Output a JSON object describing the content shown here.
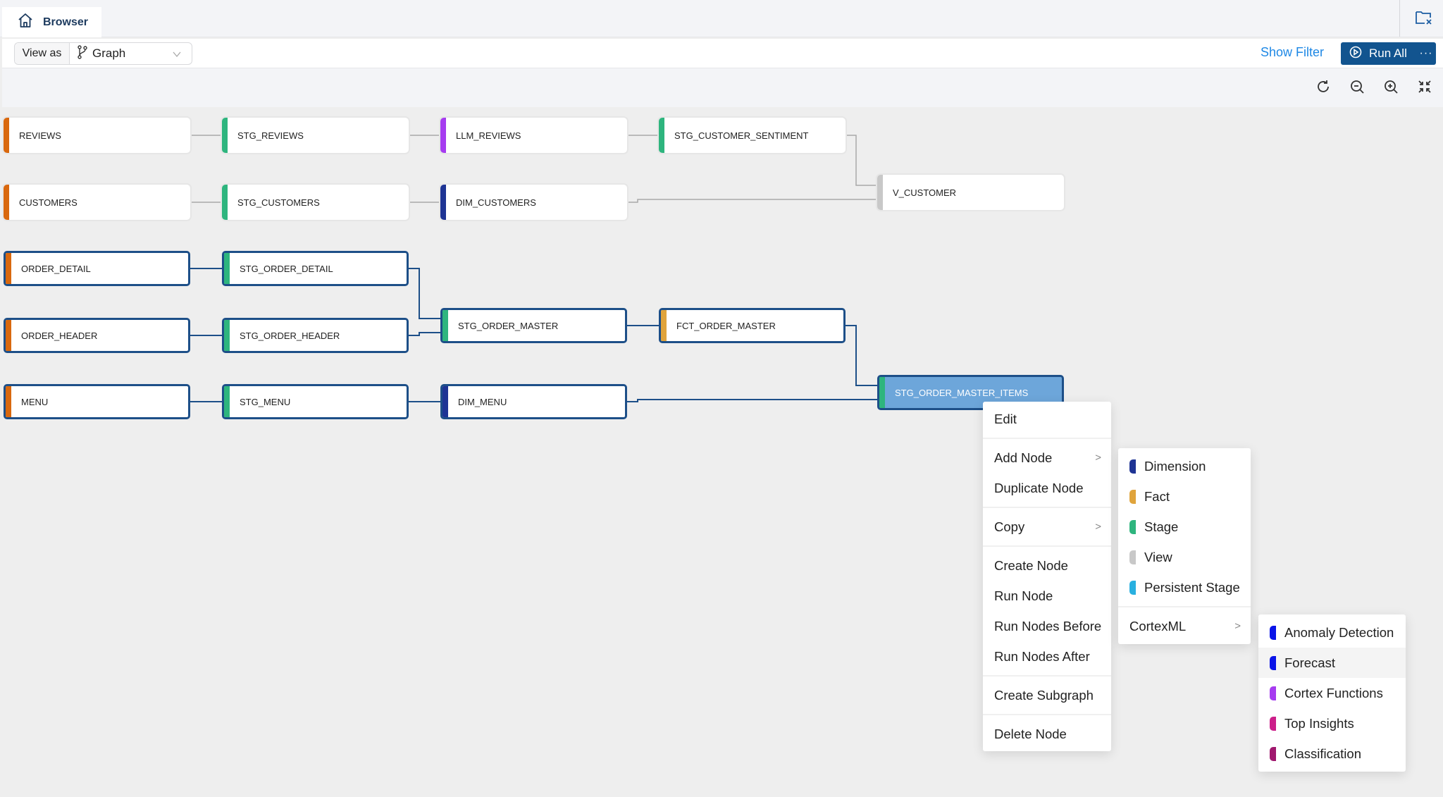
{
  "tabs": [
    {
      "label": "Browser",
      "icon": "home-icon",
      "active": true
    }
  ],
  "header_right_icon": "folder-close-icon",
  "toolbar": {
    "view_as_label": "View as",
    "view_mode": "Graph",
    "view_mode_icon": "branch-icon",
    "show_filter_label": "Show Filter",
    "run_all_label": "Run All",
    "run_all_more": "···"
  },
  "canvas_tools": [
    "refresh-icon",
    "zoom-out-icon",
    "zoom-in-icon",
    "fit-screen-icon"
  ],
  "colors": {
    "source": "#d9680e",
    "stage": "#2eb57e",
    "llm": "#a63cf0",
    "dimension": "#1e3494",
    "fact": "#e0a43c",
    "view": "#c8c8c8",
    "highlight_border": "#1d4f88",
    "selected_fill": "#6da6da",
    "accent": "#12548f",
    "link": "#1e88e5"
  },
  "nodes": [
    {
      "id": "REVIEWS",
      "label": "REVIEWS",
      "type": "source",
      "highlighted": false
    },
    {
      "id": "STG_REVIEWS",
      "label": "STG_REVIEWS",
      "type": "stage",
      "highlighted": false
    },
    {
      "id": "LLM_REVIEWS",
      "label": "LLM_REVIEWS",
      "type": "llm",
      "highlighted": false
    },
    {
      "id": "STG_CUSTOMER_SENTIMENT",
      "label": "STG_CUSTOMER_SENTIMENT",
      "type": "stage",
      "highlighted": false
    },
    {
      "id": "CUSTOMERS",
      "label": "CUSTOMERS",
      "type": "source",
      "highlighted": false
    },
    {
      "id": "STG_CUSTOMERS",
      "label": "STG_CUSTOMERS",
      "type": "stage",
      "highlighted": false
    },
    {
      "id": "DIM_CUSTOMERS",
      "label": "DIM_CUSTOMERS",
      "type": "dimension",
      "highlighted": false
    },
    {
      "id": "V_CUSTOMER",
      "label": "V_CUSTOMER",
      "type": "view",
      "highlighted": false
    },
    {
      "id": "ORDER_DETAIL",
      "label": "ORDER_DETAIL",
      "type": "source",
      "highlighted": true
    },
    {
      "id": "STG_ORDER_DETAIL",
      "label": "STG_ORDER_DETAIL",
      "type": "stage",
      "highlighted": true
    },
    {
      "id": "ORDER_HEADER",
      "label": "ORDER_HEADER",
      "type": "source",
      "highlighted": true
    },
    {
      "id": "STG_ORDER_HEADER",
      "label": "STG_ORDER_HEADER",
      "type": "stage",
      "highlighted": true
    },
    {
      "id": "STG_ORDER_MASTER",
      "label": "STG_ORDER_MASTER",
      "type": "stage",
      "highlighted": true
    },
    {
      "id": "FCT_ORDER_MASTER",
      "label": "FCT_ORDER_MASTER",
      "type": "fact",
      "highlighted": true
    },
    {
      "id": "MENU",
      "label": "MENU",
      "type": "source",
      "highlighted": true
    },
    {
      "id": "STG_MENU",
      "label": "STG_MENU",
      "type": "stage",
      "highlighted": true
    },
    {
      "id": "DIM_MENU",
      "label": "DIM_MENU",
      "type": "dimension",
      "highlighted": true
    },
    {
      "id": "STG_ORDER_MASTER_ITEMS",
      "label": "STG_ORDER_MASTER_ITEMS",
      "type": "stage",
      "highlighted": true,
      "selected": true
    }
  ],
  "edges": [
    [
      "REVIEWS",
      "STG_REVIEWS"
    ],
    [
      "STG_REVIEWS",
      "LLM_REVIEWS"
    ],
    [
      "LLM_REVIEWS",
      "STG_CUSTOMER_SENTIMENT"
    ],
    [
      "STG_CUSTOMER_SENTIMENT",
      "V_CUSTOMER"
    ],
    [
      "CUSTOMERS",
      "STG_CUSTOMERS"
    ],
    [
      "STG_CUSTOMERS",
      "DIM_CUSTOMERS"
    ],
    [
      "DIM_CUSTOMERS",
      "V_CUSTOMER"
    ],
    [
      "ORDER_DETAIL",
      "STG_ORDER_DETAIL"
    ],
    [
      "STG_ORDER_DETAIL",
      "STG_ORDER_MASTER"
    ],
    [
      "ORDER_HEADER",
      "STG_ORDER_HEADER"
    ],
    [
      "STG_ORDER_HEADER",
      "STG_ORDER_MASTER"
    ],
    [
      "STG_ORDER_MASTER",
      "FCT_ORDER_MASTER"
    ],
    [
      "FCT_ORDER_MASTER",
      "STG_ORDER_MASTER_ITEMS"
    ],
    [
      "MENU",
      "STG_MENU"
    ],
    [
      "STG_MENU",
      "DIM_MENU"
    ],
    [
      "DIM_MENU",
      "STG_ORDER_MASTER_ITEMS"
    ]
  ],
  "context_menu": {
    "groups": [
      [
        {
          "label": "Edit"
        }
      ],
      [
        {
          "label": "Add Node",
          "submenu": true
        },
        {
          "label": "Duplicate Node"
        }
      ],
      [
        {
          "label": "Copy",
          "submenu": true
        }
      ],
      [
        {
          "label": "Create Node"
        },
        {
          "label": "Run Node"
        },
        {
          "label": "Run Nodes Before"
        },
        {
          "label": "Run Nodes After"
        }
      ],
      [
        {
          "label": "Create Subgraph"
        }
      ],
      [
        {
          "label": "Delete Node"
        }
      ]
    ]
  },
  "add_node_menu": {
    "items": [
      {
        "label": "Dimension",
        "color": "#1e3494"
      },
      {
        "label": "Fact",
        "color": "#e0a43c"
      },
      {
        "label": "Stage",
        "color": "#2eb57e"
      },
      {
        "label": "View",
        "color": "#c8c8c8"
      },
      {
        "label": "Persistent Stage",
        "color": "#29b0e0"
      }
    ],
    "more": {
      "label": "CortexML",
      "submenu": true
    }
  },
  "cortexml_menu": {
    "items": [
      {
        "label": "Anomaly Detection",
        "color": "#0a14e8"
      },
      {
        "label": "Forecast",
        "color": "#0a14e8",
        "hovered": true
      },
      {
        "label": "Cortex Functions",
        "color": "#a63cf0"
      },
      {
        "label": "Top Insights",
        "color": "#cc1f8a"
      },
      {
        "label": "Classification",
        "color": "#a0186e"
      }
    ]
  }
}
